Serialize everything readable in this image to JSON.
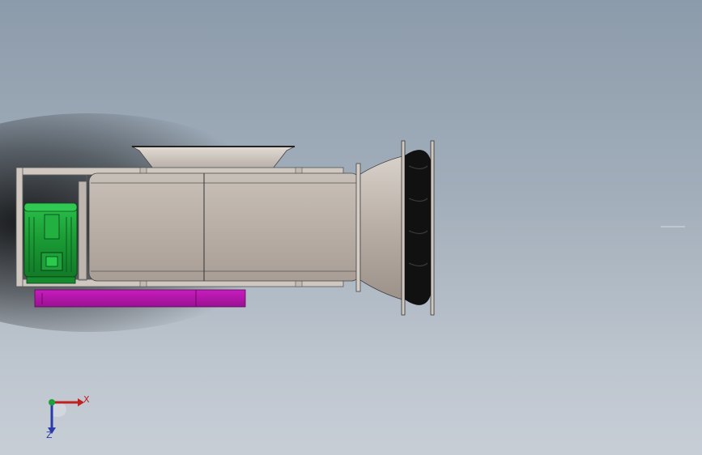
{
  "viewport": {
    "background_top": "#8c9bab",
    "background_bottom": "#c7ced6"
  },
  "model": {
    "icons": [
      "fan-housing",
      "electric-motor",
      "base-frame",
      "v-belt-pulley"
    ],
    "colors": {
      "housing": "#bdb3ab",
      "frame": "#c9c1ba",
      "motor": "#1fa83a",
      "base_plate": "#b016a8",
      "pulley": "#111111"
    }
  },
  "triad": {
    "x_label": "X",
    "y_label": "Z",
    "colors": {
      "x": "#c02020",
      "y": "#2a3aa8",
      "origin": "#1ea038"
    }
  }
}
